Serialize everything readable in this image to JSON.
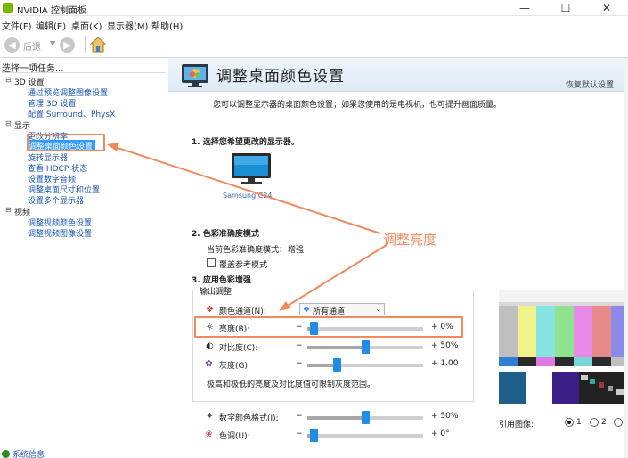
{
  "window": {
    "title": "NVIDIA 控制面板",
    "minimize_glyph": "—",
    "maximize_glyph": "☐",
    "close_glyph": "✕"
  },
  "menu": [
    "文件(F)",
    "编辑(E)",
    "桌面(K)",
    "显示器(M)",
    "帮助(H)"
  ],
  "toolbar": {
    "back_label": "后退",
    "back_icon": "back-arrow-icon",
    "forward_icon": "forward-arrow-icon",
    "home_icon": "home-icon"
  },
  "left_pane": {
    "header": "选择一项任务...",
    "sections": [
      {
        "label": "3D 设置",
        "items": [
          "通过预览调整图像设置",
          "管理 3D 设置",
          "配置 Surround、PhysX"
        ]
      },
      {
        "label": "显示",
        "items": [
          "更改分辨率",
          "调整桌面颜色设置",
          "旋转显示器",
          "查看 HDCP 状态",
          "设置数字音频",
          "调整桌面尺寸和位置",
          "设置多个显示器"
        ]
      },
      {
        "label": "视频",
        "items": [
          "调整视频颜色设置",
          "调整视频图像设置"
        ]
      }
    ],
    "selected_item": "调整桌面颜色设置",
    "system_info": "系统信息"
  },
  "main": {
    "title": "调整桌面颜色设置",
    "restore_defaults": "恢复默认设置",
    "intro": "您可以调整显示器的桌面颜色设置；如果您使用的是电视机，也可提升画面质量。",
    "step1": "1. 选择您希望更改的显示器。",
    "monitor_label": "Samsung C24",
    "step2": "2. 色彩准确度模式",
    "current_mode_label": "当前色彩准确度模式：",
    "current_mode_value": "增强",
    "override_label": "覆盖参考模式",
    "step3": "3. 应用色彩增强",
    "output_adjust": "输出调整",
    "channel_label": "颜色通道(N):",
    "channel_value": "所有通道",
    "sliders": [
      {
        "label": "亮度(B):",
        "value": "+ 0%",
        "level": 0.05,
        "icon": "brightness-icon"
      },
      {
        "label": "对比度(C):",
        "value": "+ 50%",
        "level": 0.5,
        "icon": "contrast-icon"
      },
      {
        "label": "灰度(G):",
        "value": "+ 1.00",
        "level": 0.25,
        "icon": "gamma-icon"
      }
    ],
    "note": "极高和极低的亮度及对比度值可限制灰度范围。",
    "vibrance": {
      "label": "数字颜色格式(I):",
      "value": "+ 50%",
      "level": 0.5,
      "icon": "digital-vibrance-icon"
    },
    "hue": {
      "label": "色调(U):",
      "value": "+ 0°",
      "level": 0.05,
      "icon": "hue-icon"
    },
    "reference_image": {
      "label": "引用图像:",
      "options": [
        "1",
        "2",
        "3"
      ],
      "selected": "1"
    }
  },
  "annotation": {
    "text": "调整亮度",
    "color": "#f08a5d"
  },
  "colors": {
    "accent": "#1f8ce8",
    "selection": "#3399ff",
    "nvidia_green": "#76b900"
  }
}
